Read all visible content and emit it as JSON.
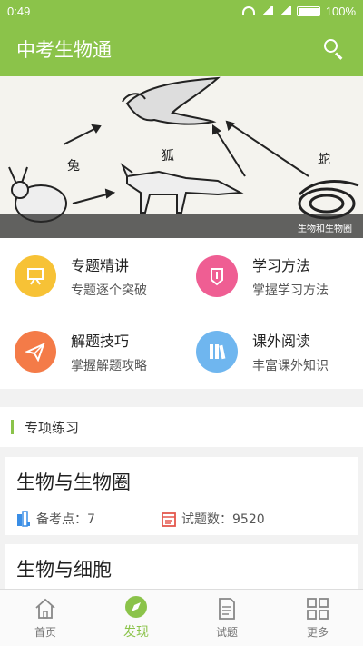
{
  "status_bar": {
    "time": "0:49",
    "battery": "100%"
  },
  "app_bar": {
    "title": "中考生物通"
  },
  "banner": {
    "labels": {
      "rabbit": "兔",
      "fox": "狐",
      "snake": "蛇"
    },
    "caption": "生物和生物圈"
  },
  "features": [
    {
      "title": "专题精讲",
      "subtitle": "专题逐个突破",
      "icon": "presentation-board-icon",
      "color": "#f7c236"
    },
    {
      "title": "学习方法",
      "subtitle": "掌握学习方法",
      "icon": "badge-pencil-icon",
      "color": "#ef5e93"
    },
    {
      "title": "解题技巧",
      "subtitle": "掌握解题攻略",
      "icon": "paper-plane-icon",
      "color": "#f47b48"
    },
    {
      "title": "课外阅读",
      "subtitle": "丰富课外知识",
      "icon": "books-icon",
      "color": "#6fb6ef"
    }
  ],
  "section": {
    "title": "专项练习"
  },
  "cards": [
    {
      "title": "生物与生物圈",
      "points": "备考点：7",
      "questions": "试题数：9520"
    },
    {
      "title": "生物与细胞"
    }
  ],
  "bottom_nav": [
    {
      "label": "首页",
      "icon": "home-icon"
    },
    {
      "label": "发现",
      "icon": "compass-icon",
      "active": true
    },
    {
      "label": "试题",
      "icon": "document-icon"
    },
    {
      "label": "更多",
      "icon": "grid-icon"
    }
  ],
  "colors": {
    "brand": "#8bc34a",
    "active_tab": "#8bc34a"
  }
}
